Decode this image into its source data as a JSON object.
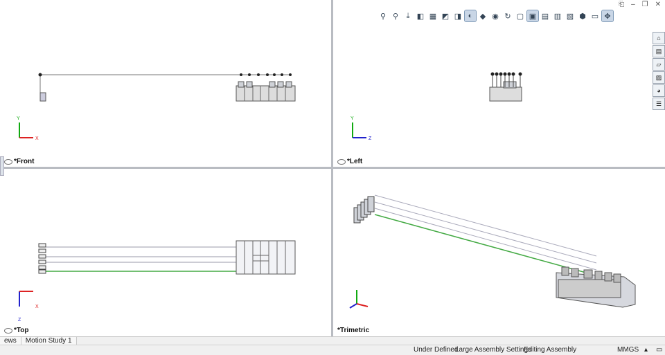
{
  "viewports": {
    "front": {
      "label": "*Front",
      "axis_a": "Y",
      "axis_b": "X"
    },
    "left": {
      "label": "*Left",
      "axis_a": "Y",
      "axis_b": "Z"
    },
    "top": {
      "label": "*Top",
      "axis_a": "Z",
      "axis_b": "X"
    },
    "trimetric": {
      "label": "*Trimetric"
    }
  },
  "heads_up_toolbar": {
    "icons": [
      "zoom-to-fit-icon",
      "zoom-to-area-icon",
      "previous-view-icon",
      "section-view-icon",
      "dynamic-annotation-icon",
      "view-orientation-icon",
      "display-style-icon",
      "hide-show-icon",
      "edit-appearance-icon",
      "apply-scene-icon",
      "rotate-icon",
      "single-view-icon",
      "four-view-icon",
      "two-view-horizontal-icon",
      "two-view-vertical-icon",
      "link-views-icon",
      "isometric-icon",
      "view-settings-icon",
      "display-manager-icon"
    ]
  },
  "task_pane": {
    "icons": [
      "home-icon",
      "design-library-icon",
      "file-explorer-icon",
      "view-palette-icon",
      "appearances-icon",
      "custom-properties-icon"
    ]
  },
  "tabs": [
    {
      "label": "ews"
    },
    {
      "label": "Motion Study 1"
    }
  ],
  "status": {
    "state": "Under Defined",
    "assembly_settings": "Large Assembly Settings",
    "mode": "Editing Assembly",
    "units": "MMGS"
  },
  "colors": {
    "axis_x": "#d22",
    "axis_y": "#1a1",
    "axis_z": "#22c",
    "accent": "#4a7ab8"
  }
}
